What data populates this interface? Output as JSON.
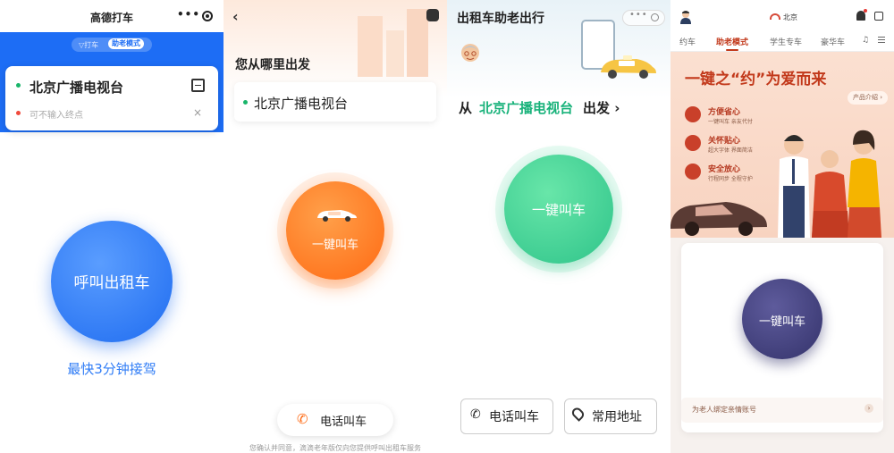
{
  "panel1": {
    "title": "高德打车",
    "more": "•••",
    "mode_normal": "▽打车",
    "mode_elder": "助老模式",
    "start_location": "北京广播电视台",
    "end_placeholder": "可不输入终点",
    "clear": "×",
    "main_button": "呼叫出租车",
    "subtitle": "最快3分钟接驾"
  },
  "panel2": {
    "back": "‹",
    "heading": "您从哪里出发",
    "start_location": "北京广播电视台",
    "main_button": "一键叫车",
    "phone_icon": "✆",
    "phone_button": "电话叫车",
    "fine_print": "您确认并同意，滴滴老年版仅向您提供呼叫出租车服务"
  },
  "panel3": {
    "title": "出租车助老出行",
    "caps_dots": "•••",
    "from": "从",
    "from_location": "北京广播电视台",
    "from_go": "出发 ›",
    "main_button": "一键叫车",
    "phone_icon": "✆",
    "phone_button": "电话叫车",
    "address_button": "常用地址"
  },
  "panel4": {
    "city": "北京",
    "tabs": [
      "约车",
      "助老模式",
      "学生专车",
      "豪华车",
      "♫"
    ],
    "headline": "一键之“约”为爱而来",
    "intro": "产品介绍 ›",
    "features": [
      {
        "title": "方便省心",
        "desc": "一键叫车 亲友代付"
      },
      {
        "title": "关怀贴心",
        "desc": "超大字体 界面简洁"
      },
      {
        "title": "安全放心",
        "desc": "行程同步 全程守护"
      }
    ],
    "main_button": "一键叫车",
    "bind_label": "为老人绑定亲情账号",
    "bind_arrow": "›"
  },
  "colors": {
    "amap_blue": "#1d6df5",
    "didi_orange": "#ff6a13",
    "green": "#2fc48a",
    "meituan_red": "#c2391b",
    "indigo": "#34336b"
  }
}
